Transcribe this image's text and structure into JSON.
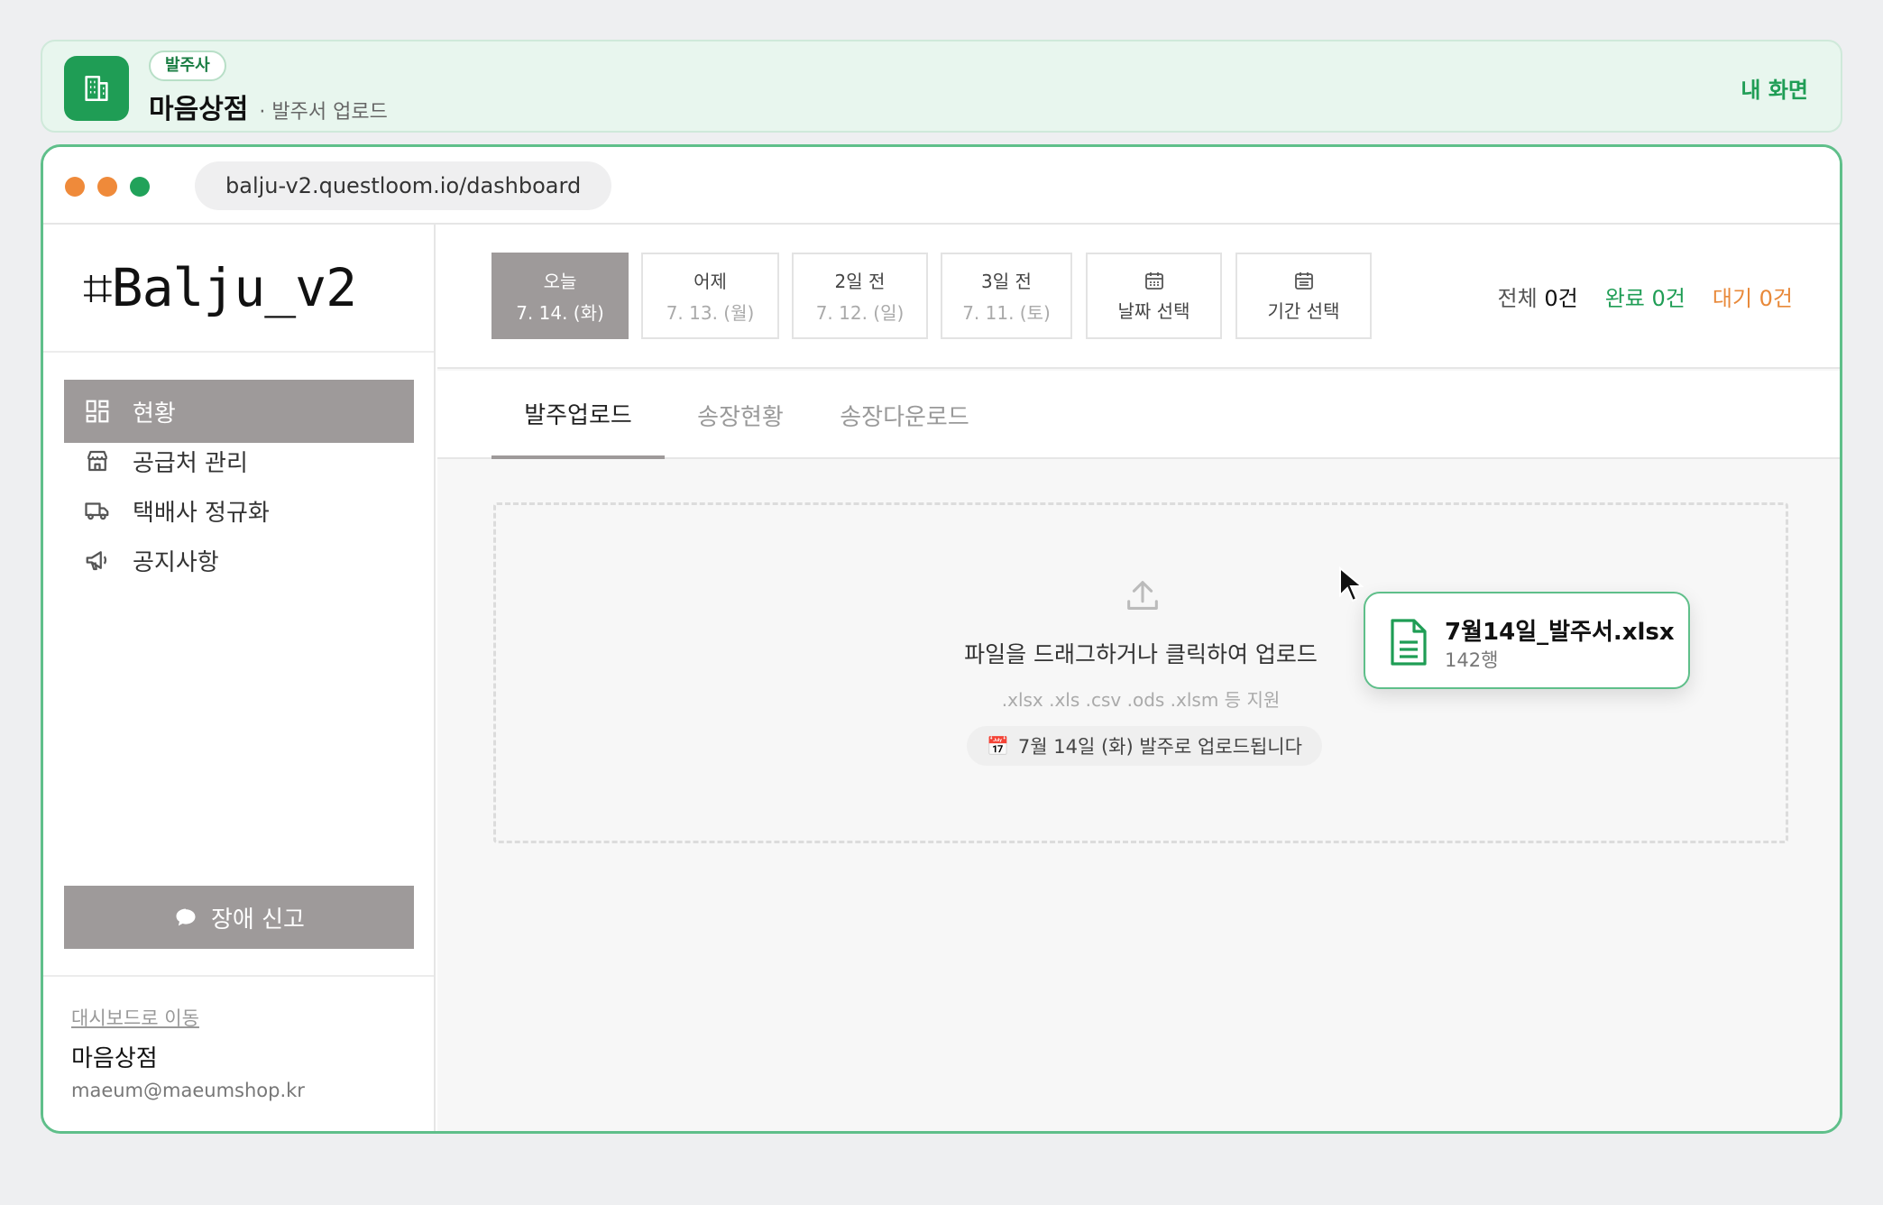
{
  "banner": {
    "tag": "발주사",
    "name": "마음상점",
    "subtitle": "· 발주서 업로드",
    "my_screen": "내 화면"
  },
  "browser": {
    "url": "balju-v2.questloom.io/dashboard"
  },
  "sidebar": {
    "logo": "⌗Balju_v2",
    "items": [
      {
        "label": "현황",
        "icon": "grid-icon",
        "active": true
      },
      {
        "label": "공급처 관리",
        "icon": "store-icon",
        "active": false
      },
      {
        "label": "택배사 정규화",
        "icon": "truck-icon",
        "active": false
      },
      {
        "label": "공지사항",
        "icon": "megaphone-icon",
        "active": false
      }
    ],
    "report_button": "장애 신고",
    "footer": {
      "dashboard_link": "대시보드로 이동",
      "shop_name": "마음상점",
      "email": "maeum@maeumshop.kr"
    }
  },
  "dates": [
    {
      "label": "오늘",
      "date": "7. 14. (화)",
      "active": true
    },
    {
      "label": "어제",
      "date": "7. 13. (월)",
      "active": false
    },
    {
      "label": "2일 전",
      "date": "7. 12. (일)",
      "active": false
    },
    {
      "label": "3일 전",
      "date": "7. 11. (토)",
      "active": false
    },
    {
      "label": "날짜 선택",
      "icon": "calendar-icon"
    },
    {
      "label": "기간 선택",
      "icon": "calendar-icon"
    }
  ],
  "counts": {
    "all_label": "전체",
    "all_value": "0건",
    "done": "완료 0건",
    "wait": "대기 0건"
  },
  "tabs": [
    "발주업로드",
    "송장현황",
    "송장다운로드"
  ],
  "dropzone": {
    "title": "파일을 드래그하거나 클릭하여 업로드",
    "formats": ".xlsx .xls .csv .ods .xlsm 등 지원",
    "notice": "7월 14일 (화) 발주로 업로드됩니다"
  },
  "dragged_file": {
    "name": "7월14일_발주서.xlsx",
    "rows": "142행"
  },
  "colors": {
    "accent": "#1f9d55",
    "wait": "#e8893a",
    "active_gray": "#9e9a9a"
  }
}
